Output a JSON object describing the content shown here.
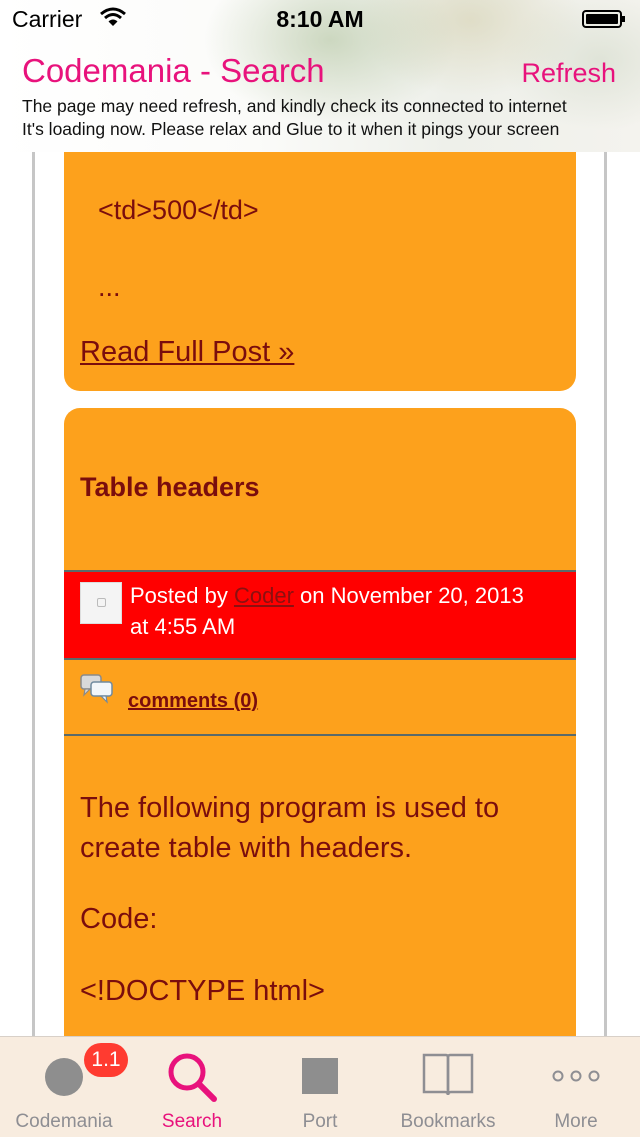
{
  "status_bar": {
    "carrier": "Carrier",
    "time": "8:10 AM"
  },
  "header": {
    "title": "Codemania - Search",
    "refresh_label": "Refresh",
    "notice_line1": "The page may need refresh, and kindly check its connected to internet",
    "notice_line2": "It's loading now. Please relax and Glue to it when it pings your screen"
  },
  "post1": {
    "code_line": "<td>500</td>",
    "ellipsis": "...",
    "read_more": "Read Full Post »"
  },
  "post2": {
    "title": "Table headers",
    "posted_by": "Posted by",
    "author": "Coder",
    "date_line1": "on November 20, 2013",
    "date_line2": "at 4:55 AM",
    "comments": "comments (0)",
    "body_line1": "The following program is used to",
    "body_line2": "create table with headers.",
    "code_label": "Code:",
    "doctype": "<!DOCTYPE html>"
  },
  "tabs": [
    {
      "label": "Codemania",
      "icon": "circle-icon",
      "badge": "1.1"
    },
    {
      "label": "Search",
      "icon": "search-icon",
      "active": true
    },
    {
      "label": "Port",
      "icon": "square-icon"
    },
    {
      "label": "Bookmarks",
      "icon": "book-icon"
    },
    {
      "label": "More",
      "icon": "more-dots-icon"
    }
  ],
  "colors": {
    "accent": "#e8127c",
    "card": "#fda11c",
    "card_text": "#7a0d0d",
    "meta_bar": "#ff0000",
    "tab_bar": "#f8ecdf"
  }
}
